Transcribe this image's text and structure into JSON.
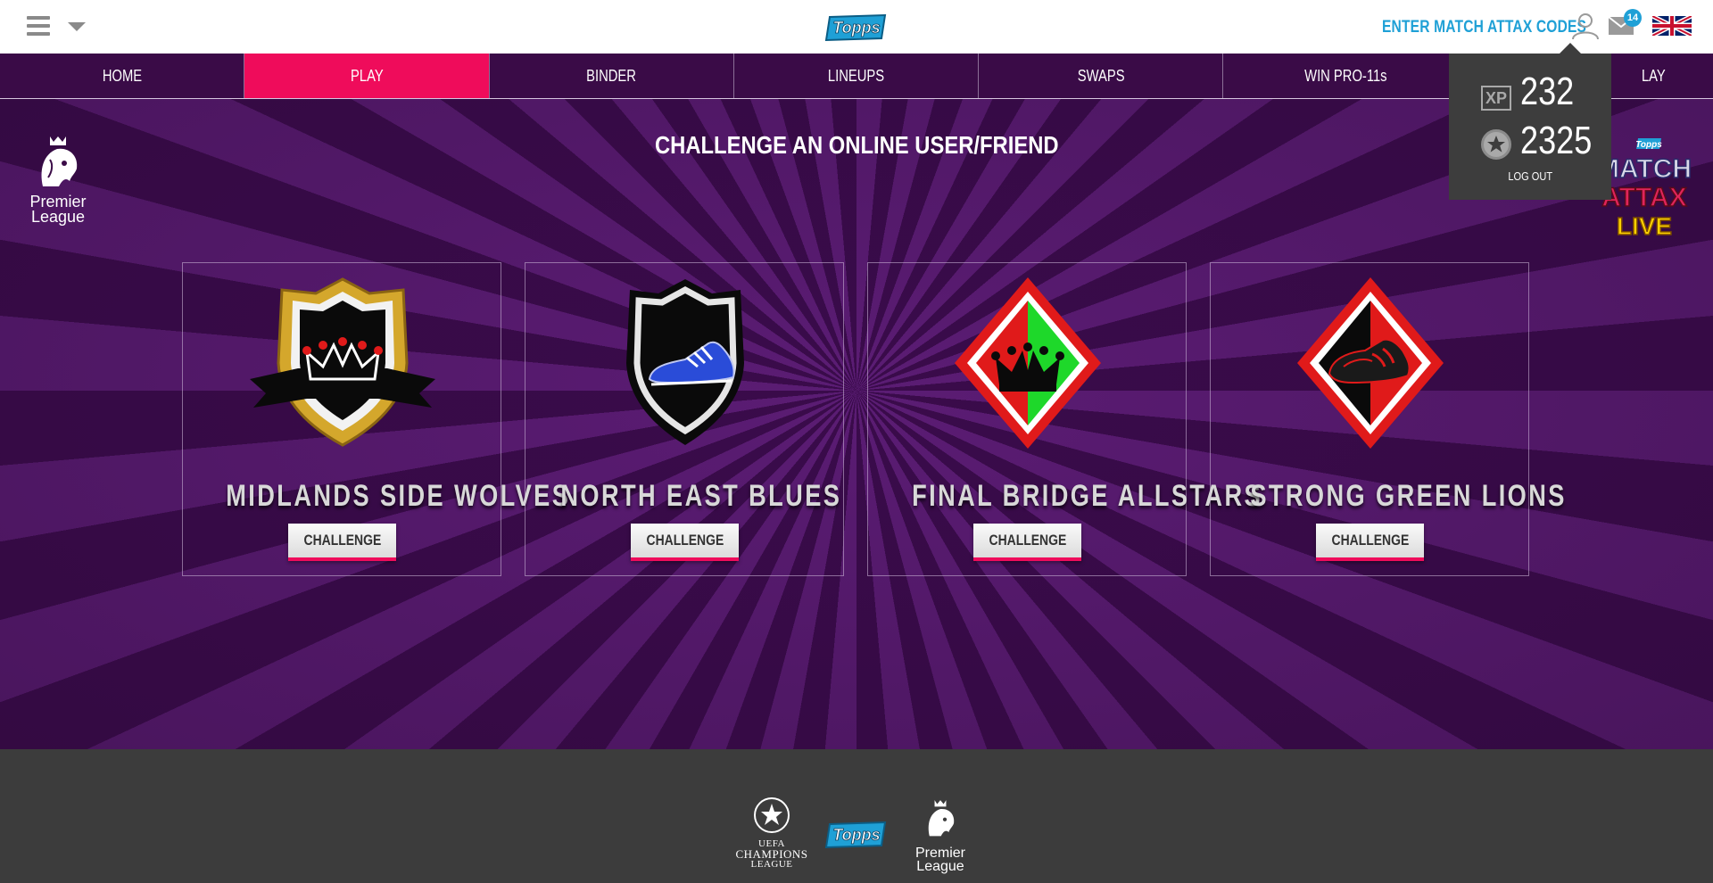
{
  "header": {
    "codes_link": "ENTER MATCH ATTAX CODES",
    "mail_count": "14",
    "icons": [
      "menu-icon",
      "caret-down-icon",
      "topps-logo",
      "user-icon",
      "mail-icon",
      "uk-flag-icon"
    ]
  },
  "nav": {
    "items": [
      {
        "label": "HOME",
        "active": false
      },
      {
        "label": "PLAY",
        "active": true
      },
      {
        "label": "BINDER",
        "active": false
      },
      {
        "label": "LINEUPS",
        "active": false
      },
      {
        "label": "SWAPS",
        "active": false
      },
      {
        "label": "WIN PRO-11s",
        "active": false
      },
      {
        "label": "LAY",
        "active": false
      }
    ]
  },
  "main": {
    "heading": "CHALLENGE AN ONLINE USER/FRIEND",
    "pl_logo_text": [
      "Premier",
      "League"
    ],
    "teams": [
      {
        "name": "MIDLANDS SIDE WOLVES",
        "button": "CHALLENGE",
        "crest": "gold-shield-crown-crest"
      },
      {
        "name": "NORTH EAST BLUES",
        "button": "CHALLENGE",
        "crest": "black-shield-boot-crest"
      },
      {
        "name": "FINAL BRIDGE ALLSTARS",
        "button": "CHALLENGE",
        "crest": "red-green-diamond-crown-crest"
      },
      {
        "name": "STRONG GREEN LIONS",
        "button": "CHALLENGE",
        "crest": "red-black-diamond-boot-crest"
      }
    ]
  },
  "user_panel": {
    "xp_label": "XP",
    "xp_value": "232",
    "coins_value": "2325",
    "logout": "LOG OUT"
  },
  "footer": {
    "ucl_text": [
      "UEFA",
      "CHAMPIONS",
      "LEAGUE"
    ],
    "pl_text": [
      "Premier",
      "League"
    ]
  },
  "colors": {
    "accent_pink": "#ef0c5b",
    "link_blue": "#1fa0d6",
    "nav_purple": "#3a0b47"
  }
}
